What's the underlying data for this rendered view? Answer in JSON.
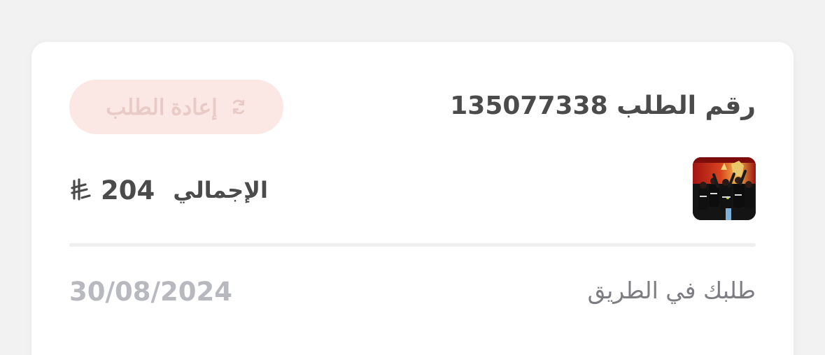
{
  "order": {
    "title": "رقم الطلب 135077338",
    "reorder_label": "إعادة الطلب",
    "total_label": "الإجمالي",
    "total_value": "204",
    "status": "طلبك في الطريق",
    "date": "30/08/2024"
  },
  "icons": {
    "reorder": "refresh-icon",
    "currency": "riyal-currency-icon",
    "thumbnail": "order-item-thumbnail"
  },
  "colors": {
    "button_bg": "#fbe7e4",
    "button_text": "#e8cbc6",
    "primary_text": "#4b4b4b",
    "secondary_text": "#7c7c82",
    "date_text": "#b8b9bf",
    "divider": "#efeff0"
  }
}
